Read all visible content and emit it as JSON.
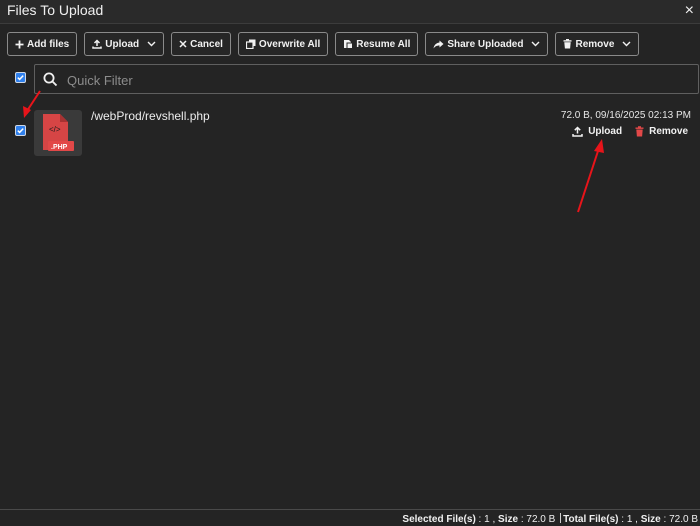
{
  "window": {
    "title": "Files To Upload",
    "close_glyph": "×"
  },
  "toolbar": {
    "add_files": "Add files",
    "upload": "Upload",
    "cancel": "Cancel",
    "overwrite_all": "Overwrite All",
    "resume_all": "Resume All",
    "share_uploaded": "Share Uploaded",
    "remove": "Remove"
  },
  "filter": {
    "placeholder": "Quick Filter",
    "value": ""
  },
  "files": [
    {
      "path": "/webProd/revshell.php",
      "badge": ".PHP",
      "code_glyph": "</>",
      "meta": "72.0 B, 09/16/2025 02:13 PM",
      "upload_label": "Upload",
      "remove_label": "Remove",
      "checked": true
    }
  ],
  "status": {
    "selected_label": "Selected File(s)",
    "selected_count": "1",
    "selected_size_label": "Size",
    "selected_size": "72.0 B",
    "total_label": "Total File(s)",
    "total_count": "1",
    "total_size_label": "Size",
    "total_size": "72.0 B"
  },
  "colors": {
    "accent": "#2f80ed",
    "annotation_arrow": "#e8141a",
    "php_icon": "#d64545",
    "remove_icon": "#e24848"
  },
  "icons": [
    "plus-icon",
    "upload-icon",
    "close-icon",
    "copy-icon",
    "resume-icon",
    "share-icon",
    "trash-icon",
    "chevron-down-icon",
    "search-icon",
    "php-file-icon",
    "check-icon"
  ]
}
